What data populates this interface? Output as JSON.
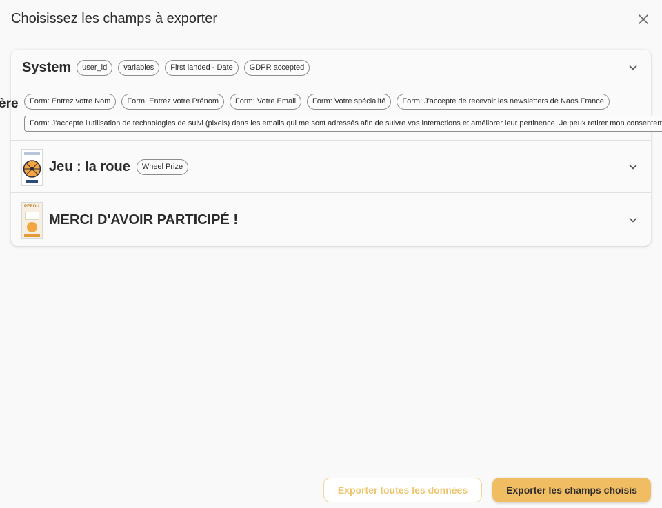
{
  "modal": {
    "title": "Choisissez les champs à exporter"
  },
  "system_section": {
    "title": "System",
    "chips": [
      "user_id",
      "variables",
      "First landed - Date",
      "GDPR accepted"
    ]
  },
  "form_section": {
    "partial_title": "ère",
    "chips_row1": [
      "Form: Entrez votre Nom",
      "Form: Entrez votre Prénom",
      "Form: Votre Email",
      "Form: Votre spécialité",
      "Form: J'accepte de recevoir les newsletters de Naos France"
    ],
    "chip_long": "Form: J'accepte l'utilisation de technologies de suivi (pixels) dans les emails qui me sont adressés afin de suivre vos interactions et améliorer leur pertinence. Je peux retirer mon consentement à"
  },
  "wheel_section": {
    "title": "Jeu : la roue",
    "chips": [
      "Wheel Prize"
    ]
  },
  "merci_section": {
    "title": "MERCI D'AVOIR PARTICIPÉ !",
    "thumb_text": "PERDU"
  },
  "footer": {
    "export_all_label": "Exporter toutes les données",
    "export_selected_label": "Exporter les champs choisis"
  },
  "colors": {
    "accent": "#f0bd62",
    "accent_light": "#f1d39e",
    "text": "#2b2b2b",
    "background": "#f9f9f9"
  }
}
